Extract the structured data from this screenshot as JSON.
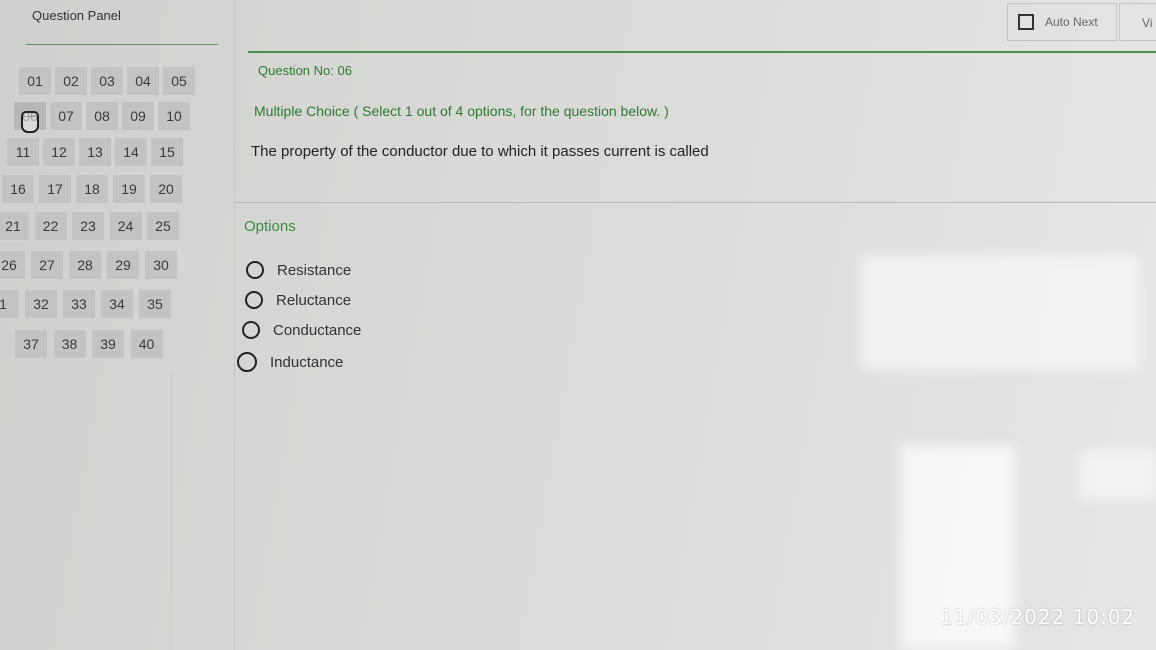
{
  "question_panel": {
    "title": "Question Panel",
    "current": "06",
    "rows": [
      [
        "01",
        "02",
        "03",
        "04",
        "05"
      ],
      [
        "06",
        "07",
        "08",
        "09",
        "10"
      ],
      [
        "11",
        "12",
        "13",
        "14",
        "15"
      ],
      [
        "16",
        "17",
        "18",
        "19",
        "20"
      ],
      [
        "21",
        "22",
        "23",
        "24",
        "25"
      ],
      [
        "26",
        "27",
        "28",
        "29",
        "30"
      ],
      [
        "1",
        "32",
        "33",
        "34",
        "35"
      ],
      [
        "37",
        "38",
        "39",
        "40"
      ]
    ]
  },
  "toolbar": {
    "auto_next_label": "Auto Next",
    "view_label": "Vi"
  },
  "question": {
    "number_label": "Question No: 06",
    "type_label": "Multiple Choice ( Select 1 out of 4 options, for the question below. )",
    "text": "The property of the conductor due to which it passes current is called"
  },
  "options": {
    "heading": "Options",
    "items": [
      "Resistance",
      "Reluctance",
      "Conductance",
      "Inductance"
    ]
  },
  "overlay": {
    "timestamp": "11/03/2022 10:02"
  }
}
